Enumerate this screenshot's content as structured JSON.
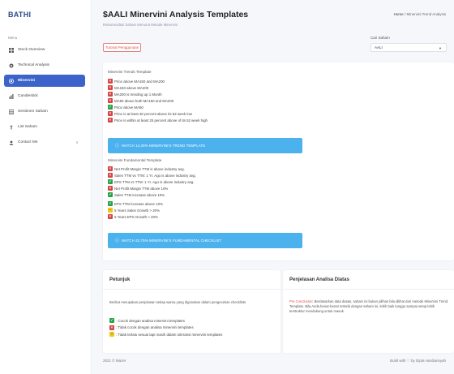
{
  "brand": "BATHI",
  "sidebar": {
    "heading": "Menu",
    "items": [
      {
        "label": "Stock Overview",
        "icon": "grid-icon"
      },
      {
        "label": "Technical Analysis",
        "icon": "gear-icon"
      },
      {
        "label": "Minervini",
        "icon": "target-icon",
        "active": true
      },
      {
        "label": "Candlestick",
        "icon": "bar-chart-icon"
      },
      {
        "label": "Sentimen Saham",
        "icon": "table-icon"
      },
      {
        "label": "List Saham",
        "icon": "list-icon"
      },
      {
        "label": "Contact Me",
        "icon": "users-icon",
        "chevron": "∨"
      }
    ]
  },
  "header": {
    "title": "$AALI Minervini Analysis Templates",
    "subtitle": "Rekomendasi Saham Menurut Metode Minervini",
    "breadcrumb_home": "Home",
    "breadcrumb_sep": "/",
    "breadcrumb_current": "Minervini Trend Analysis"
  },
  "controls": {
    "tutorial_label": "Tutorial Penggunaan",
    "stock_label": "Cari Saham",
    "stock_value": "AALI"
  },
  "trend": {
    "title": "Minervini Trends Template",
    "items": [
      {
        "status": "fail",
        "text": "Price above MA150 and MA200"
      },
      {
        "status": "fail",
        "text": "MA150 above MA200"
      },
      {
        "status": "fail",
        "text": "MA200 is trending up 1 Month"
      },
      {
        "status": "fail",
        "text": "MA50 above both MA150 and MA200"
      },
      {
        "status": "pass",
        "text": "Price above MA50"
      },
      {
        "status": "fail",
        "text": "Price is at least 30 percent above its 52 week low"
      },
      {
        "status": "fail",
        "text": "Price is within at least 25 percent above of its 52 week high"
      }
    ],
    "result": "MATCH 14.29% MINERVINI'S TREND TEMPLATE"
  },
  "fundamental": {
    "title": "Minervini Fundamental Template",
    "items": [
      {
        "status": "fail",
        "text": "Net Profit Margin TTM is above industry avg."
      },
      {
        "status": "fail",
        "text": "Sales TTM vs TTM: 1 Yr. Ago is above industry avg."
      },
      {
        "status": "pass",
        "text": "EPS TTM vs TTM: 1 Yr. Ago is above industry avg."
      },
      {
        "status": "fail",
        "text": "Net Profit Margin TTM above 10%"
      },
      {
        "status": "pass",
        "text": "Sales TTM increase above 10%"
      },
      {
        "status": "pass",
        "text": "EPS TTM increase above 10%"
      },
      {
        "status": "neutral",
        "text": "5 Years Sales Growth > 20%"
      },
      {
        "status": "fail",
        "text": "5 Years EPS Growth > 20%"
      }
    ],
    "result": "MATCH 42.75% MINERVINI'S FUNDAMENTAL CHECKLIST"
  },
  "petunjuk": {
    "title": "Petunjuk",
    "text": "Berikut merupakan penjelasan setiap warna yang digunakan dalam pengecekan checklists",
    "legend": [
      {
        "status": "pass",
        "text": ": Cocok dengan analisa minervini templates"
      },
      {
        "status": "fail",
        "text": ": Tidak cocok dengan analisa minervini templates"
      },
      {
        "status": "neutral",
        "text": ": Tidak terlalu sesuai tapi masih dalam toleransi minervini templates"
      }
    ]
  },
  "penjelasan": {
    "title": "Penjelasan Analisa Diatas",
    "conclusion_key": "Pre Conclusion",
    "text": ": Berdasarkan data diatas, saham ini bukan pilihan bila dilihat dari metode Minervini Trend Template. Bila Anda benar-benar tertarik dengan saham ini, lebih baik tunggu sampai setup lebih terstruktur mendukung untuk masuk."
  },
  "footer": {
    "left": "2021 © Mazer",
    "right_prefix": "Build with",
    "heart": "♡",
    "right_suffix": "by Dipta Hardiansyah"
  }
}
